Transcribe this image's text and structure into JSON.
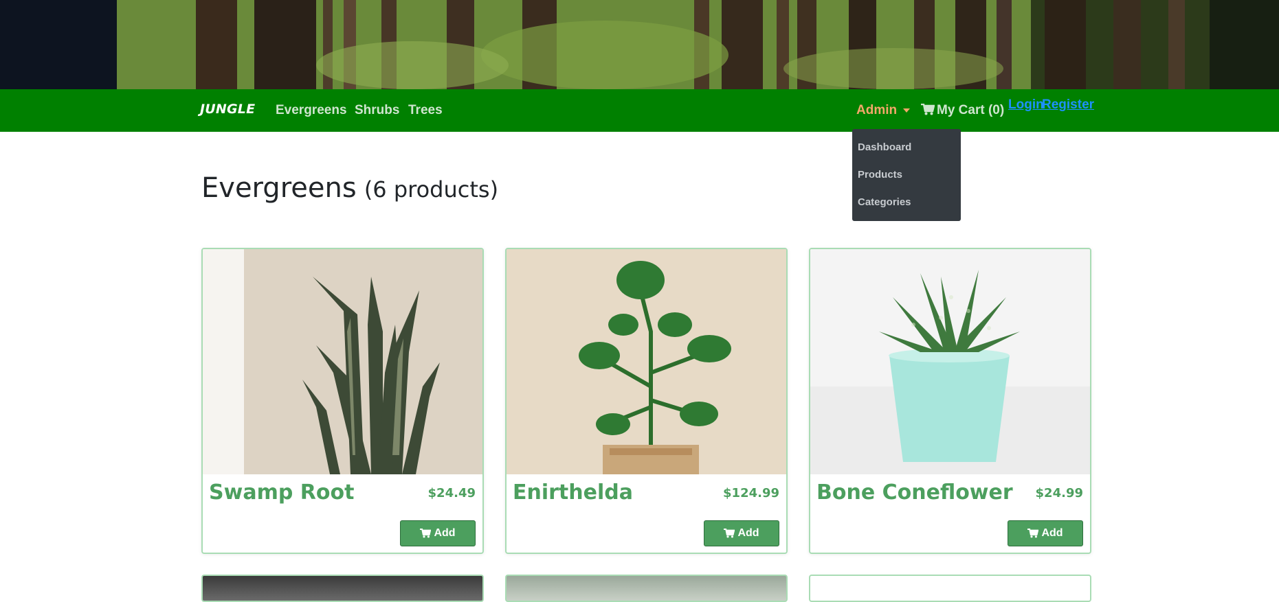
{
  "navbar": {
    "brand": "JUNGLE",
    "links": [
      "Evergreens",
      "Shrubs",
      "Trees"
    ],
    "admin_label": "Admin",
    "cart_label": "My Cart (0)",
    "login_label": "Login",
    "register_label": "Register"
  },
  "admin_menu": {
    "items": [
      "Dashboard",
      "Products",
      "Categories"
    ]
  },
  "page": {
    "category": "Evergreens",
    "count": "(6 products)"
  },
  "products": [
    {
      "name": "Swamp Root",
      "price": "$24.49",
      "add_label": "Add"
    },
    {
      "name": "Enirthelda",
      "price": "$124.99",
      "add_label": "Add"
    },
    {
      "name": "Bone Coneflower",
      "price": "$24.99",
      "add_label": "Add"
    }
  ],
  "colors": {
    "navbar": "#008000",
    "accent_green": "#4c9f5e",
    "admin_orange": "#f4a86a",
    "dropdown_bg": "#343a40",
    "link_blue": "#1e90ff"
  },
  "icons": [
    "cart-icon",
    "caret-down-icon"
  ]
}
